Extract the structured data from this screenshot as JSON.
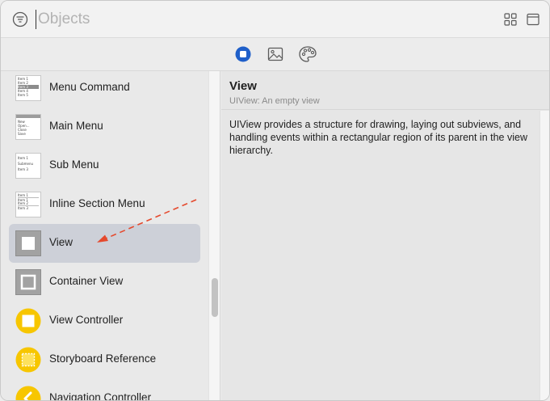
{
  "search": {
    "placeholder": "Objects",
    "value": ""
  },
  "segments": [
    {
      "name": "objects",
      "icon": "square-in-circle-icon",
      "selected": true
    },
    {
      "name": "media",
      "icon": "image-icon",
      "selected": false
    },
    {
      "name": "colors",
      "icon": "palette-icon",
      "selected": false
    }
  ],
  "list": {
    "items": [
      {
        "label": "Menu Command",
        "icon": "menu-command-thumb",
        "thumb_rows": [
          "Item 1",
          "Item 2",
          "Item 3",
          "Item 4",
          "Item 5"
        ]
      },
      {
        "label": "Main Menu",
        "icon": "main-menu-thumb",
        "thumb_rows": [
          "New",
          "Open...",
          "Close",
          "Save"
        ]
      },
      {
        "label": "Sub Menu",
        "icon": "sub-menu-thumb",
        "thumb_rows": [
          "Item 1",
          "Submenu",
          "Item 3"
        ]
      },
      {
        "label": "Inline Section Menu",
        "icon": "inline-section-menu-thumb",
        "thumb_rows": [
          "Item 1",
          "Item 1",
          "Item 2",
          "Item 3"
        ]
      },
      {
        "label": "View",
        "icon": "view-square-icon",
        "selected": true
      },
      {
        "label": "Container View",
        "icon": "container-view-icon"
      },
      {
        "label": "View Controller",
        "icon": "view-controller-icon"
      },
      {
        "label": "Storyboard Reference",
        "icon": "storyboard-reference-icon"
      },
      {
        "label": "Navigation Controller",
        "icon": "navigation-controller-icon"
      }
    ]
  },
  "detail": {
    "title": "View",
    "subtitle": "UIView: An empty view",
    "description": "UIView provides a structure for drawing, laying out subviews, and handling events within a rectangular region of its parent in the view hierarchy."
  },
  "colors": {
    "accent_blue": "#1f5fc9",
    "selection": "#cdd0d8",
    "controller_yellow": "#f7c600",
    "arrow_red": "#e5492d"
  }
}
